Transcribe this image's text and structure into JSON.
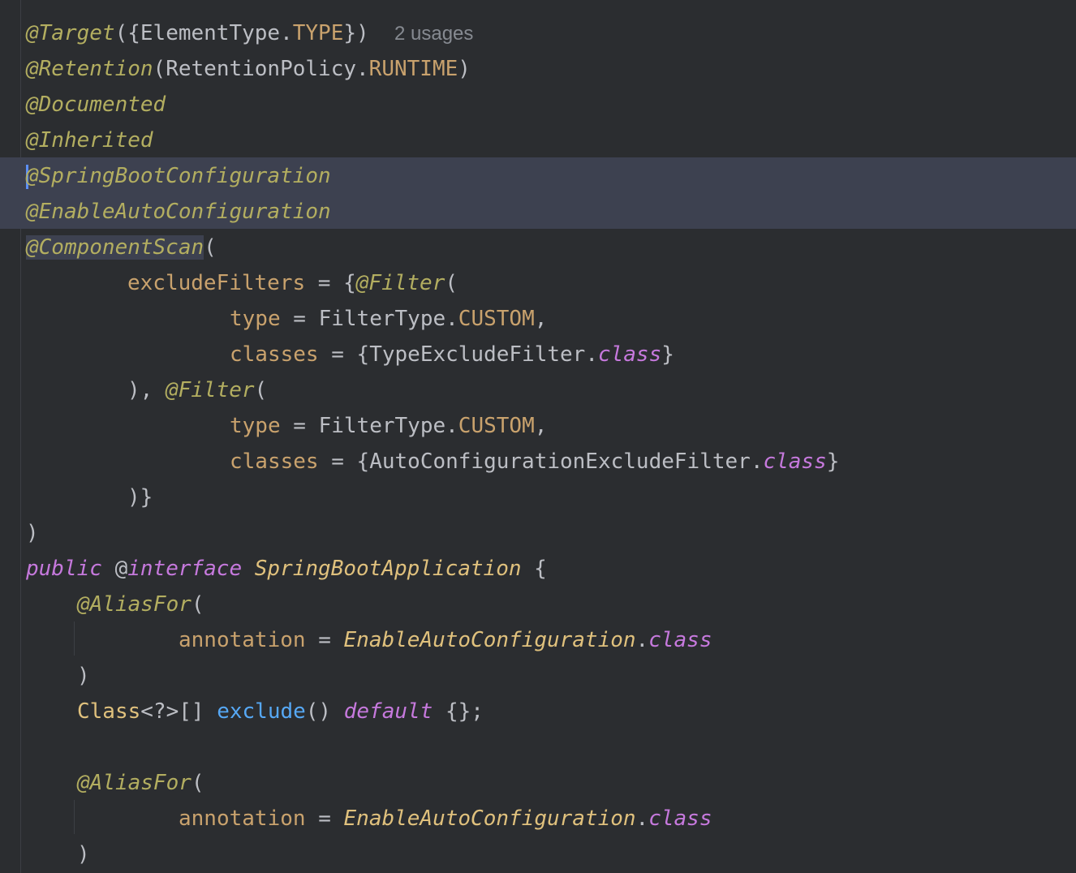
{
  "editor": {
    "lines": [
      {
        "id": "l1",
        "tokens": [
          "@Target",
          "({",
          "ElementType",
          ".",
          "TYPE",
          "})",
          "  ",
          "2 usages"
        ]
      },
      {
        "id": "l2",
        "tokens": [
          "@Retention",
          "(",
          "RetentionPolicy",
          ".",
          "RUNTIME",
          ")"
        ]
      },
      {
        "id": "l3",
        "tokens": [
          "@Documented"
        ]
      },
      {
        "id": "l4",
        "tokens": [
          "@Inherited"
        ]
      },
      {
        "id": "l5",
        "tokens": [
          "@SpringBootConfiguration"
        ]
      },
      {
        "id": "l6",
        "tokens": [
          "@EnableAutoConfiguration"
        ]
      },
      {
        "id": "l7",
        "tokens": [
          "@ComponentScan",
          "("
        ]
      },
      {
        "id": "l8",
        "tokens": [
          "excludeFilters",
          " = {",
          "@Filter",
          "("
        ]
      },
      {
        "id": "l9",
        "tokens": [
          "type",
          " = ",
          "FilterType",
          ".",
          "CUSTOM",
          ","
        ]
      },
      {
        "id": "l10",
        "tokens": [
          "classes",
          " = {",
          "TypeExcludeFilter",
          ".",
          "class",
          "}"
        ]
      },
      {
        "id": "l11",
        "tokens": [
          "), ",
          "@Filter",
          "("
        ]
      },
      {
        "id": "l12",
        "tokens": [
          "type",
          " = ",
          "FilterType",
          ".",
          "CUSTOM",
          ","
        ]
      },
      {
        "id": "l13",
        "tokens": [
          "classes",
          " = {",
          "AutoConfigurationExcludeFilter",
          ".",
          "class",
          "}"
        ]
      },
      {
        "id": "l14",
        "tokens": [
          ")}"
        ]
      },
      {
        "id": "l15",
        "tokens": [
          ")"
        ]
      },
      {
        "id": "l16",
        "tokens": [
          "public",
          " ",
          "@",
          "interface",
          " ",
          "SpringBootApplication",
          " {"
        ]
      },
      {
        "id": "l17",
        "tokens": [
          "@AliasFor",
          "("
        ]
      },
      {
        "id": "l18",
        "tokens": [
          "annotation",
          " = ",
          "EnableAutoConfiguration",
          ".",
          "class"
        ]
      },
      {
        "id": "l19",
        "tokens": [
          ")"
        ]
      },
      {
        "id": "l20",
        "tokens": [
          "Class",
          "<?>[] ",
          "exclude",
          "() ",
          "default",
          " {};"
        ]
      },
      {
        "id": "l21",
        "tokens": []
      },
      {
        "id": "l22",
        "tokens": [
          "@AliasFor",
          "("
        ]
      },
      {
        "id": "l23",
        "tokens": [
          "annotation",
          " = ",
          "EnableAutoConfiguration",
          ".",
          "class"
        ]
      },
      {
        "id": "l24",
        "tokens": [
          ")"
        ]
      }
    ]
  },
  "colors": {
    "background": "#2b2d30",
    "annotation": "#b3ae60",
    "keyword": "#c679dd",
    "constant": "#c9a26d",
    "class_italic": "#e0c17d",
    "method": "#56a8f5",
    "highlight": "#3d4150",
    "caret": "#5c8ff6"
  }
}
